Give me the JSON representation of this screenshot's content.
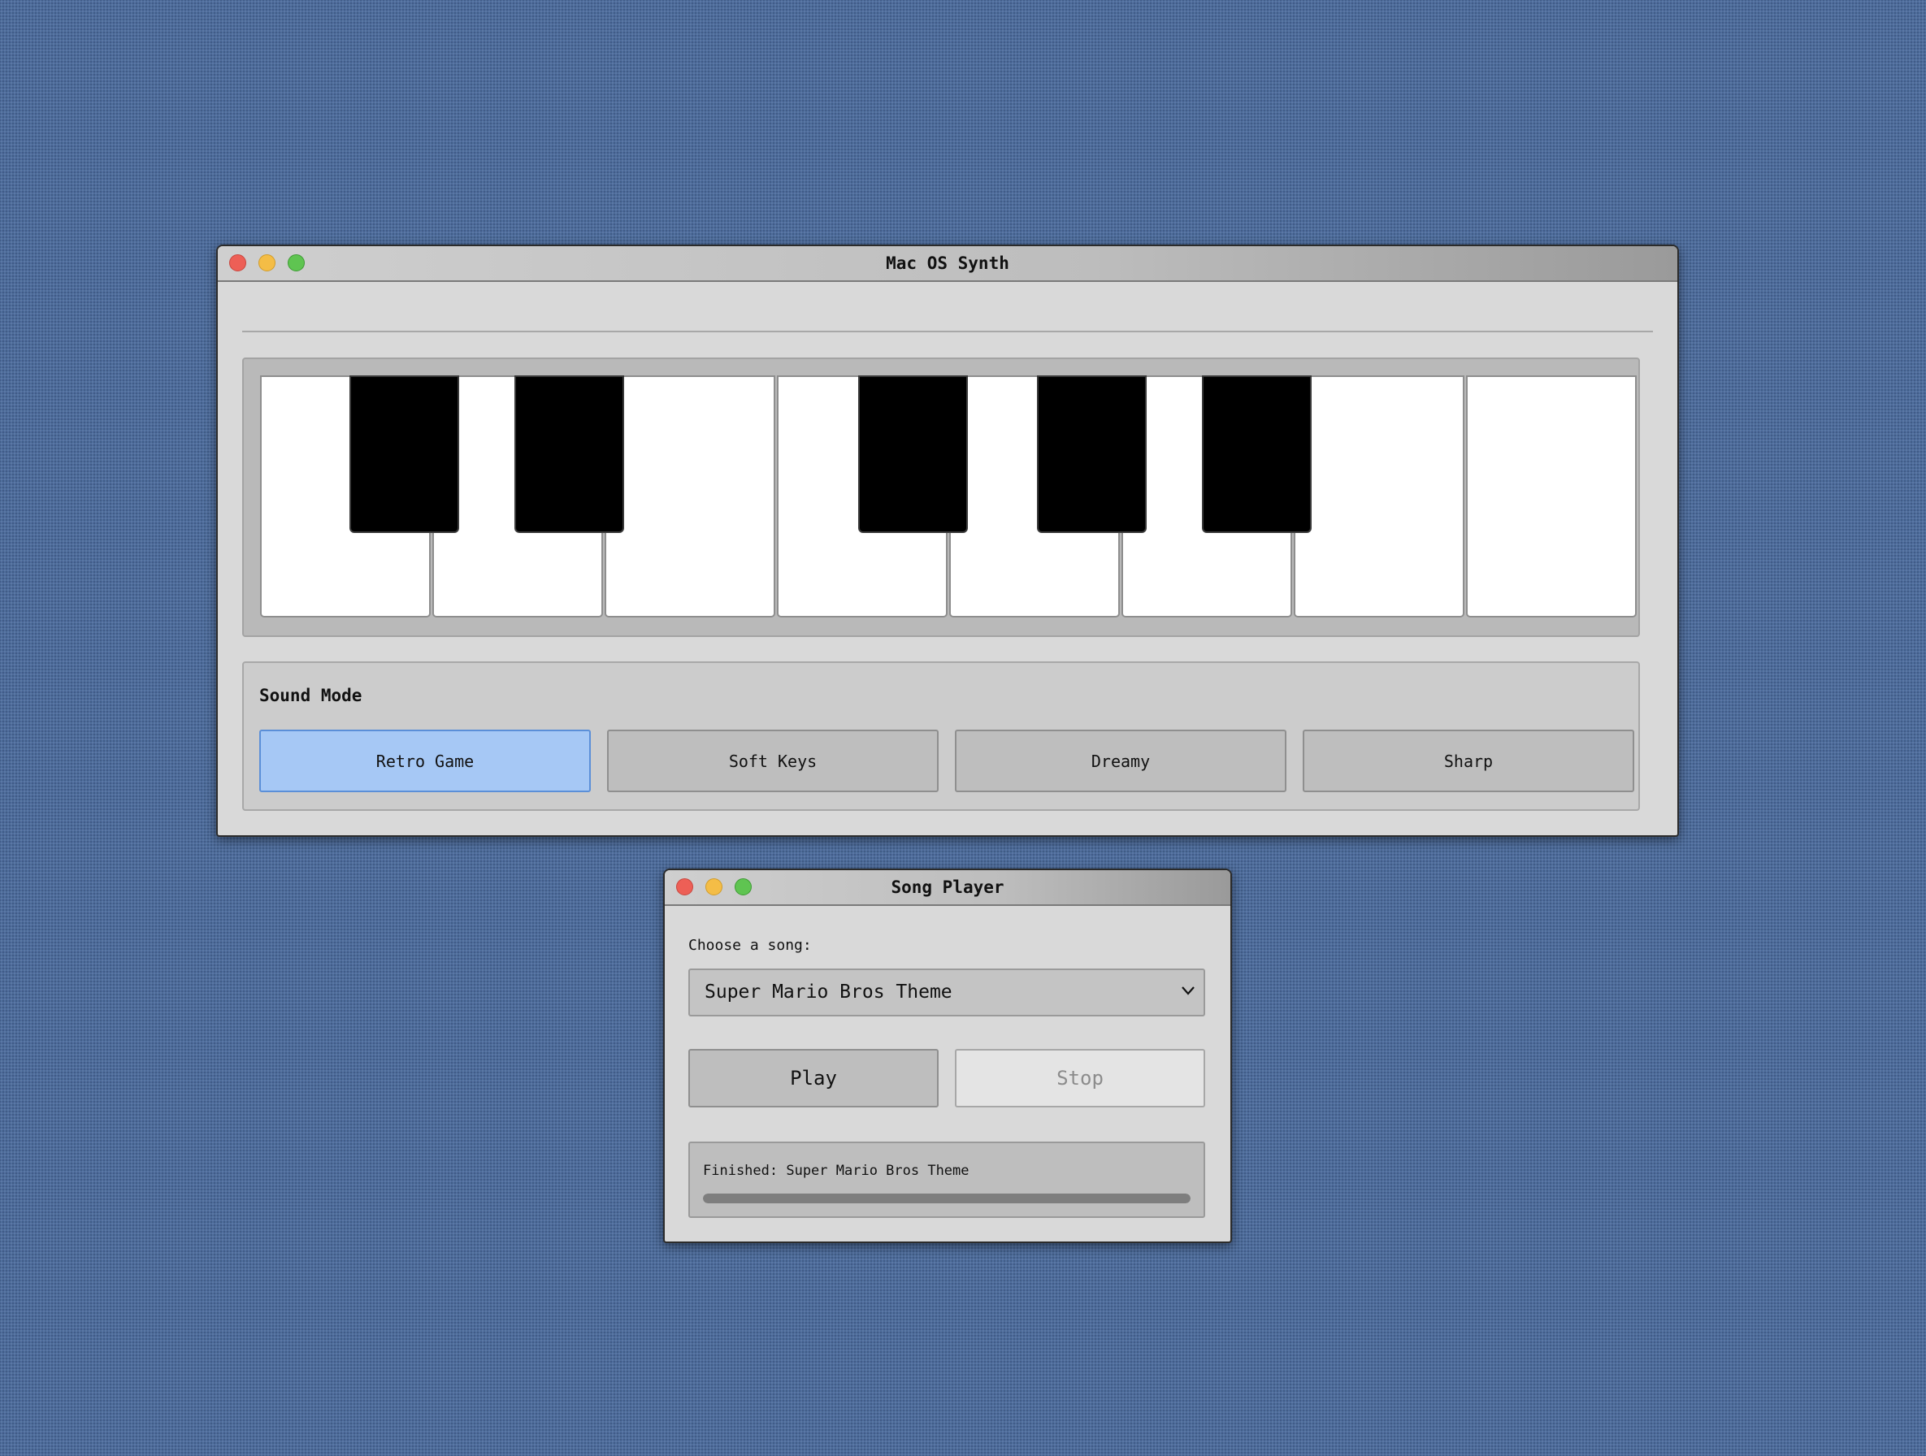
{
  "synth_window": {
    "title": "Mac OS Synth",
    "sound_mode": {
      "label": "Sound Mode",
      "options": [
        "Retro Game",
        "Soft Keys",
        "Dreamy",
        "Sharp"
      ],
      "selected": "Retro Game"
    },
    "keyboard": {
      "white_keys": 8,
      "black_keys": 5
    }
  },
  "song_player": {
    "title": "Song Player",
    "choose_label": "Choose a song:",
    "selected_song": "Super Mario Bros Theme",
    "play_label": "Play",
    "stop_label": "Stop",
    "stop_enabled": false,
    "status": "Finished: Super Mario Bros Theme",
    "progress": 1.0
  },
  "colors": {
    "desktop": "#4d6c9c",
    "window": "#d9d9d9",
    "active_mode": "#a6c8f5",
    "close": "#ed5f56",
    "minimize": "#f4bd46",
    "maximize": "#5fc451"
  },
  "icons": [
    "close-icon",
    "minimize-icon",
    "maximize-icon",
    "chevron-down-icon"
  ]
}
